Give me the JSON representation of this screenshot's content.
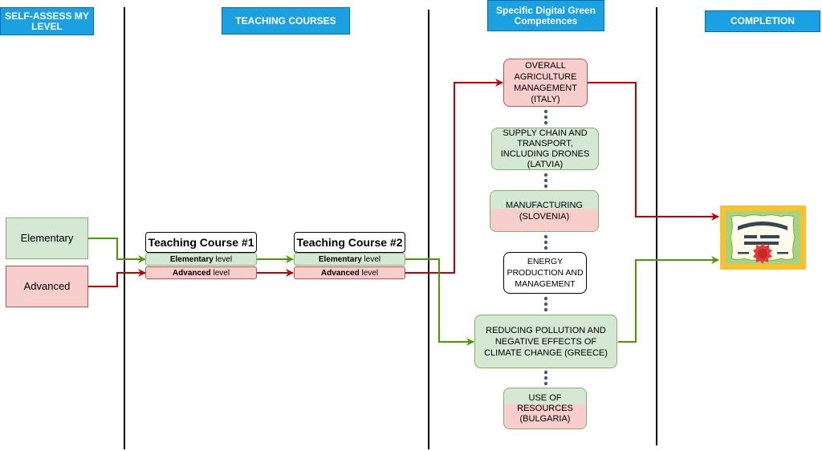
{
  "headers": {
    "self_assess": "SELF-ASSESS MY LEVEL",
    "teaching_courses": "TEACHING COURSES",
    "competences": "Specific Digital Green Competences",
    "completion": "COMPLETION"
  },
  "levels": {
    "elementary": "Elementary",
    "advanced": "Advanced"
  },
  "courses": [
    {
      "title": "Teaching Course #1",
      "elementary_strong": "Elementary",
      "advanced_strong": "Advanced",
      "suffix": " level"
    },
    {
      "title": "Teaching Course #2",
      "elementary_strong": "Elementary",
      "advanced_strong": "Advanced",
      "suffix": " level"
    }
  ],
  "competences": [
    {
      "label": "OVERALL AGRICULTURE MANAGEMENT (ITALY)",
      "level": "advanced"
    },
    {
      "label": "SUPPLY CHAIN AND TRANSPORT, INCLUDING DRONES (LATVIA)",
      "level": "elementary"
    },
    {
      "label": "MANUFACTURING (SLOVENIA)",
      "level": "both"
    },
    {
      "label": "ENERGY PRODUCTION AND MANAGEMENT",
      "level": "none"
    },
    {
      "label": "REDUCING POLLUTION AND NEGATIVE EFFECTS OF CLIMATE CHANGE (GREECE)",
      "level": "elementary"
    },
    {
      "label": "USE OF RESOURCES (BULGARIA)",
      "level": "both"
    }
  ],
  "completion": {
    "icon": "certificate-icon"
  },
  "colors": {
    "header_blue": "#1ba1e2",
    "elementary_fill": "#d5e8d4",
    "elementary_line": "#4d9900",
    "advanced_fill": "#f8cecc",
    "advanced_line": "#c00000"
  }
}
